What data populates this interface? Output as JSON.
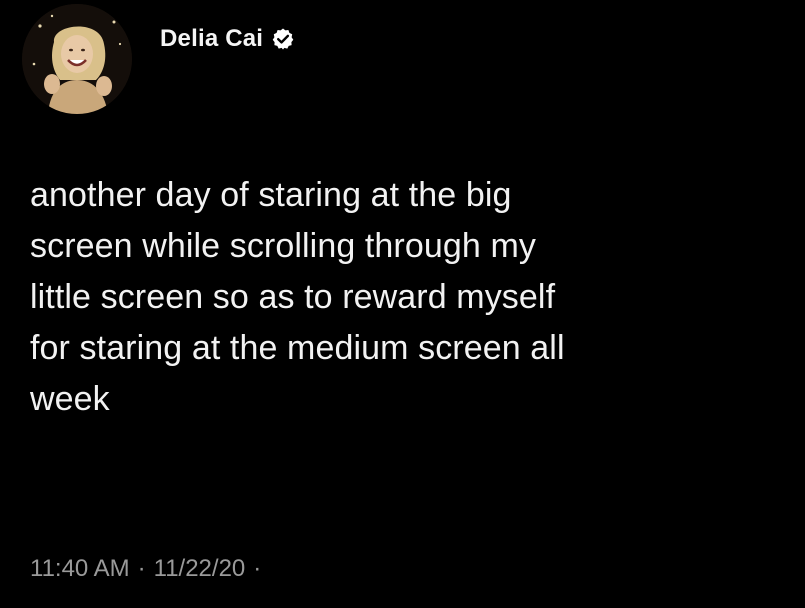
{
  "tweet": {
    "author": {
      "display_name": "Delia Cai",
      "verified": true,
      "avatar_icon": "profile-photo"
    },
    "text": "another day of staring at the big\nscreen while scrolling through my\nlittle screen so as to reward myself\nfor staring at the medium screen all\nweek",
    "time": "11:40 AM",
    "separator": "·",
    "date": "11/22/20",
    "trailing_separator": "·"
  },
  "colors": {
    "background": "#000000",
    "text": "#f2f2f2",
    "meta_text": "#9a9a9a",
    "verified_badge": "#ffffff"
  }
}
